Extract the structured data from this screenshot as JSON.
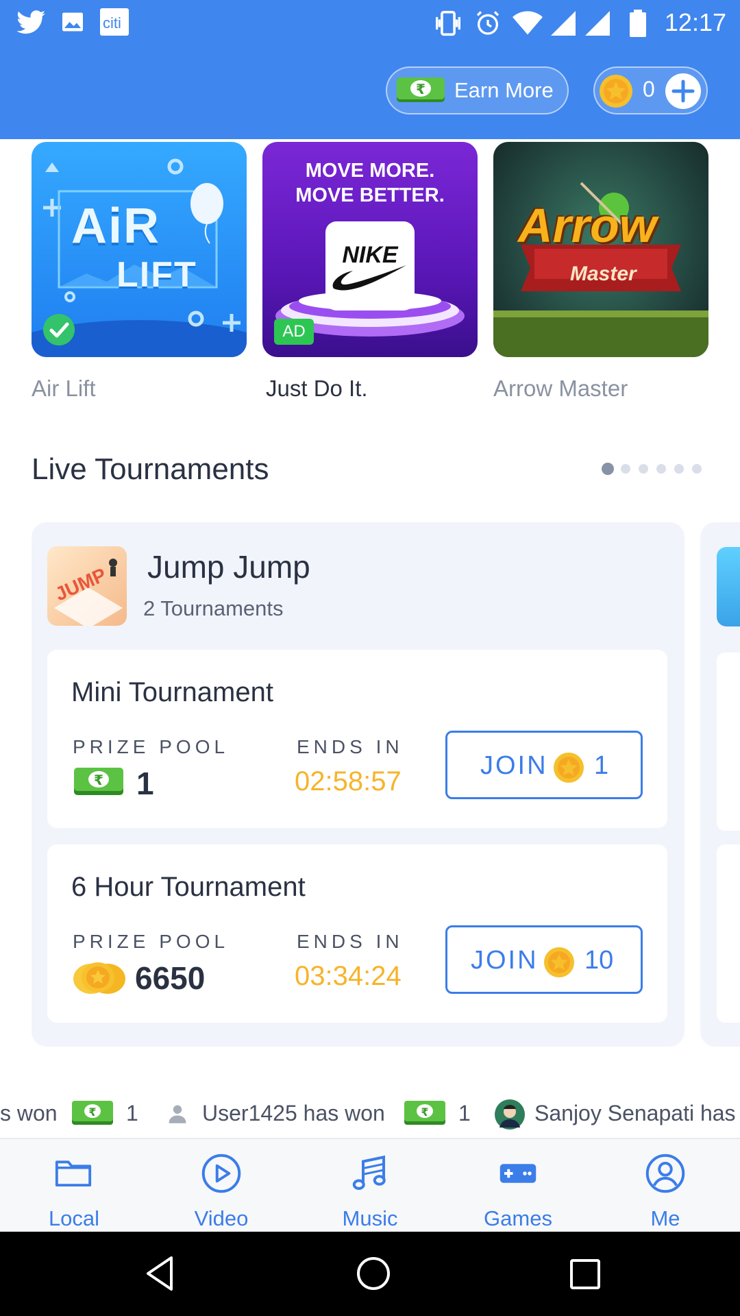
{
  "status_bar": {
    "time": "12:17",
    "icons": [
      "twitter-icon",
      "gallery-icon",
      "citi-icon",
      "vibrate-icon",
      "alarm-icon",
      "wifi-icon",
      "signal-icon",
      "signal-icon",
      "battery-icon"
    ],
    "citi_label": "citi"
  },
  "header": {
    "earn_more_label": "Earn More",
    "coin_count": "0"
  },
  "banners": [
    {
      "caption": "Air Lift",
      "air": "AiR",
      "lift": "LIFT"
    },
    {
      "caption": "Just Do It.",
      "headline_1": "MOVE MORE.",
      "headline_2": "MOVE BETTER.",
      "brand": "NIKE",
      "ad_badge": "AD"
    },
    {
      "caption": "Arrow Master",
      "title": "Arrow",
      "subtitle": "Master"
    }
  ],
  "live": {
    "title": "Live Tournaments",
    "page_dots": 6,
    "active_dot": 0
  },
  "game": {
    "name": "Jump Jump",
    "count_label": "2 Tournaments",
    "logo_text": "JUMP"
  },
  "tournaments": [
    {
      "name": "Mini Tournament",
      "prize_label": "PRIZE POOL",
      "prize_value": "1",
      "prize_type": "cash",
      "ends_label": "ENDS IN",
      "ends_value": "02:58:57",
      "join_label": "JOIN",
      "join_cost": "1"
    },
    {
      "name": "6 Hour Tournament",
      "prize_label": "PRIZE POOL",
      "prize_value": "6650",
      "prize_type": "coins",
      "ends_label": "ENDS IN",
      "ends_value": "03:34:24",
      "join_label": "JOIN",
      "join_cost": "10"
    }
  ],
  "ticker": {
    "seg1_text": "s won",
    "seg1_amount": "1",
    "seg2_text": "User1425 has won",
    "seg2_amount": "1",
    "seg3_text": "Sanjoy Senapati has"
  },
  "bottom_nav": [
    {
      "label": "Local",
      "icon": "folder-icon"
    },
    {
      "label": "Video",
      "icon": "play-circle-icon"
    },
    {
      "label": "Music",
      "icon": "music-note-icon"
    },
    {
      "label": "Games",
      "icon": "gamepad-icon"
    },
    {
      "label": "Me",
      "icon": "user-circle-icon"
    }
  ],
  "colors": {
    "primary_blue": "#3f86ef",
    "accent_blue": "#3b7de9",
    "timer_orange": "#f6b42a",
    "card_bg": "#f1f4fa",
    "cash_green": "#4caf3a",
    "coin_gold": "#f5c02c"
  }
}
